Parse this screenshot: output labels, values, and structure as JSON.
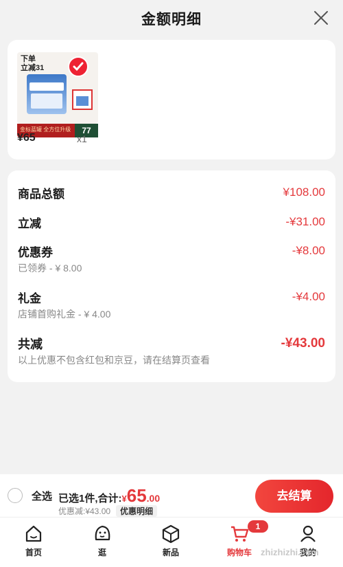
{
  "header": {
    "title": "金额明细",
    "close_icon": "close-icon"
  },
  "product": {
    "promo_text": "下单\n立减31",
    "bar_text": "金标蓝罐 全方位升级",
    "bar_number": "77",
    "price": "¥65",
    "quantity": "x1"
  },
  "details": [
    {
      "label": "商品总额",
      "value": "¥108.00",
      "sub": ""
    },
    {
      "label": "立减",
      "value": "-¥31.00",
      "sub": ""
    },
    {
      "label": "优惠券",
      "value": "-¥8.00",
      "sub": "已领券 - ¥ 8.00"
    },
    {
      "label": "礼金",
      "value": "-¥4.00",
      "sub": "店铺首购礼金 - ¥ 4.00"
    }
  ],
  "total": {
    "label": "共减",
    "value": "-¥43.00",
    "note": "以上优惠不包含红包和京豆，请在结算页查看"
  },
  "bottom_bar": {
    "select_all": "全选",
    "selected": "已选1件,合计:",
    "currency": "¥",
    "amount_int": "65",
    "amount_dec": ".00",
    "discount": "优惠减:¥43.00",
    "detail_tag": "优惠明细",
    "checkout": "去结算"
  },
  "tabs": [
    {
      "label": "首页",
      "icon": "home-icon"
    },
    {
      "label": "逛",
      "icon": "face-icon"
    },
    {
      "label": "新品",
      "icon": "box-icon"
    },
    {
      "label": "购物车",
      "icon": "cart-icon",
      "badge": "1"
    },
    {
      "label": "我的",
      "icon": "user-icon"
    }
  ],
  "watermark": "zhizhizhi.com",
  "colors": {
    "accent": "#e4393c",
    "background": "#f2f2f2"
  }
}
